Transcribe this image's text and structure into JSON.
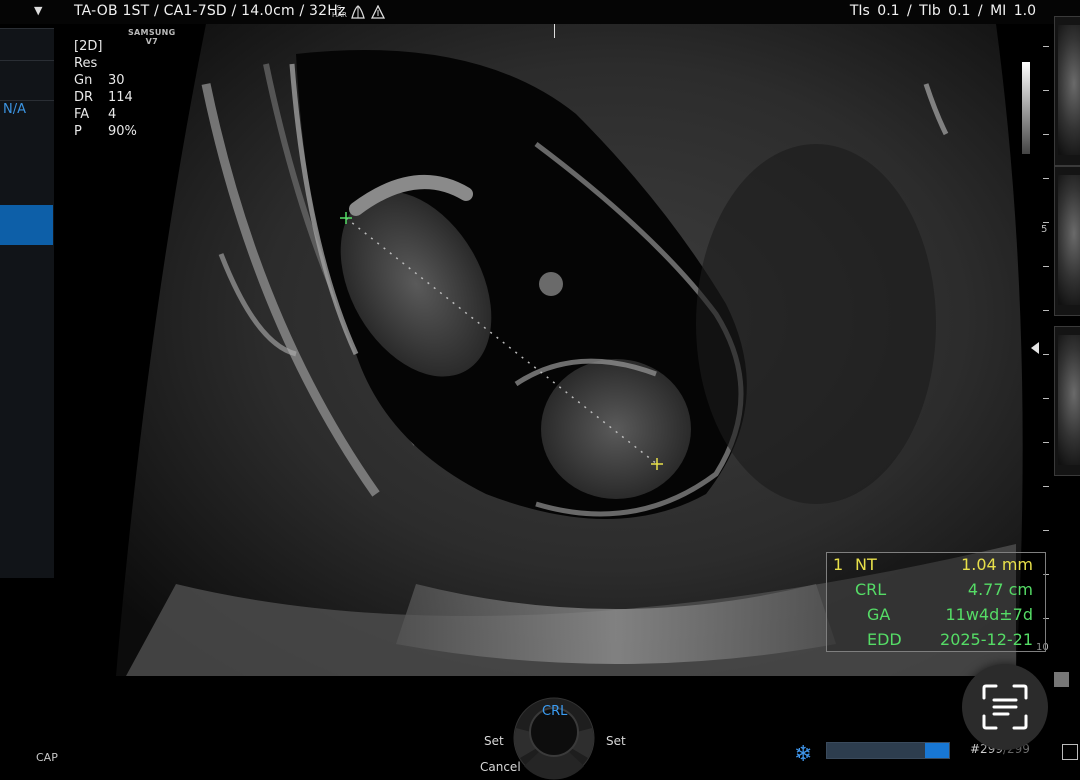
{
  "header": {
    "exam_info": "TA-OB 1ST / CA1-7SD / 14.0cm / 32Hz",
    "sharp_icon_text": "S\nHAR",
    "index_info": "TIs  0.1 / TIb  0.1 / MI   1.0"
  },
  "brand": {
    "line1": "SAMSUNG",
    "line2": "V7"
  },
  "left_panel": {
    "na_label": "N/A",
    "cap_label": "CAP"
  },
  "params": {
    "mode": "[2D]",
    "res": "Res",
    "rows": [
      {
        "key": "Gn",
        "value": "30"
      },
      {
        "key": "DR",
        "value": "114"
      },
      {
        "key": "FA",
        "value": "4"
      },
      {
        "key": "P",
        "value": "90%"
      }
    ]
  },
  "depth_scale": {
    "labels": [
      "5",
      "10"
    ]
  },
  "measurements": {
    "index": "1",
    "rows": [
      {
        "name": "NT",
        "value": "1.04 mm"
      },
      {
        "name": "CRL",
        "value": "4.77 cm"
      },
      {
        "name": "GA",
        "value": "11w4d±7d"
      },
      {
        "name": "EDD",
        "value": "2025-12-21"
      }
    ]
  },
  "controls": {
    "dial_center": "CRL",
    "set_left": "Set",
    "set_right": "Set",
    "cancel": "Cancel",
    "frame_current": "#299",
    "frame_total": "/299",
    "cine_progress": 0.2
  },
  "colors": {
    "accent_blue": "#3b9cf2",
    "meas_yellow": "#e8e04a",
    "meas_green": "#55dc66"
  },
  "icons": [
    "menu-arrow-icon",
    "sharp-icon",
    "probe-icon",
    "freeze-snowflake-icon",
    "text-scan-icon"
  ]
}
